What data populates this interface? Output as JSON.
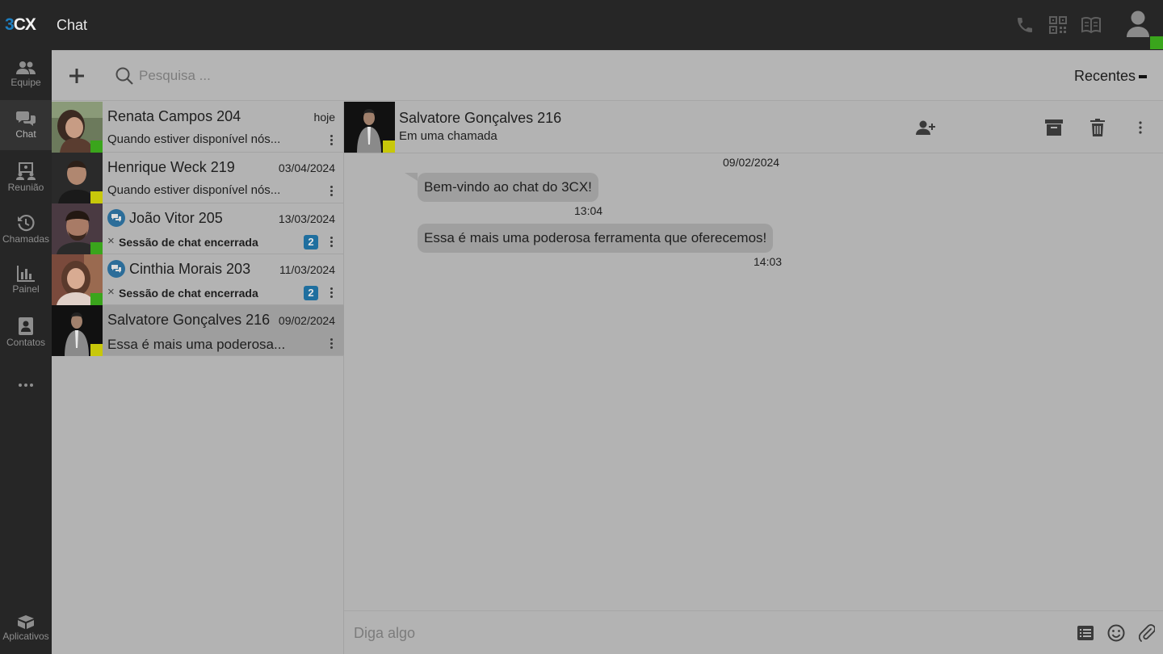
{
  "app": {
    "logo_3": "3",
    "logo_cx": "CX",
    "title": "Chat"
  },
  "topbar_icons": [
    "phone-icon",
    "qr-code-icon",
    "book-icon",
    "user-profile-icon"
  ],
  "nav": {
    "items": [
      {
        "label": "Equipe",
        "icon": "team-icon"
      },
      {
        "label": "Chat",
        "icon": "chat-icon"
      },
      {
        "label": "Reunião",
        "icon": "meeting-icon"
      },
      {
        "label": "Chamadas",
        "icon": "history-icon"
      },
      {
        "label": "Painel",
        "icon": "chart-icon"
      },
      {
        "label": "Contatos",
        "icon": "contacts-icon"
      },
      {
        "label": "Aplicativos",
        "icon": "apps-icon"
      }
    ],
    "more": "more-icon"
  },
  "toolbar": {
    "search_placeholder": "Pesquisa ...",
    "sort_label": "Recentes"
  },
  "conversations": [
    {
      "name": "Renata Campos 204",
      "date": "hoje",
      "preview": "Quando estiver disponível nós...",
      "presence": "#3aa51c",
      "ended": false,
      "badge": null
    },
    {
      "name": "Henrique Weck 219",
      "date": "03/04/2024",
      "preview": "Quando estiver disponível nós...",
      "presence": "#c8c80a",
      "ended": false,
      "badge": null
    },
    {
      "name": "João Vitor 205",
      "date": "13/03/2024",
      "preview": "Sessão de chat encerrada",
      "presence": "#3aa51c",
      "ended": true,
      "badge": "2"
    },
    {
      "name": "Cinthia Morais 203",
      "date": "11/03/2024",
      "preview": "Sessão de chat encerrada",
      "presence": "#3aa51c",
      "ended": true,
      "badge": "2"
    },
    {
      "name": "Salvatore Gonçalves 216",
      "date": "09/02/2024",
      "preview": "Essa é mais uma poderosa...",
      "presence": "#c8c80a",
      "ended": false,
      "badge": null,
      "selected": true
    }
  ],
  "chat": {
    "contact_name": "Salvatore Gonçalves 216",
    "contact_status": "Em uma chamada",
    "date_separator": "09/02/2024",
    "messages": [
      {
        "text": "Bem-vindo ao chat do 3CX!",
        "time": "13:04"
      },
      {
        "text": "Essa é mais uma poderosa ferramenta que oferecemos!",
        "time": "14:03"
      }
    ]
  },
  "composer": {
    "placeholder": "Diga algo"
  },
  "colors": {
    "topbar": "#262626",
    "brand_blue": "#1d7ec0",
    "presence_green": "#3aa51c",
    "presence_yellow": "#c8c80a",
    "badge_blue": "#1f6f9f"
  }
}
